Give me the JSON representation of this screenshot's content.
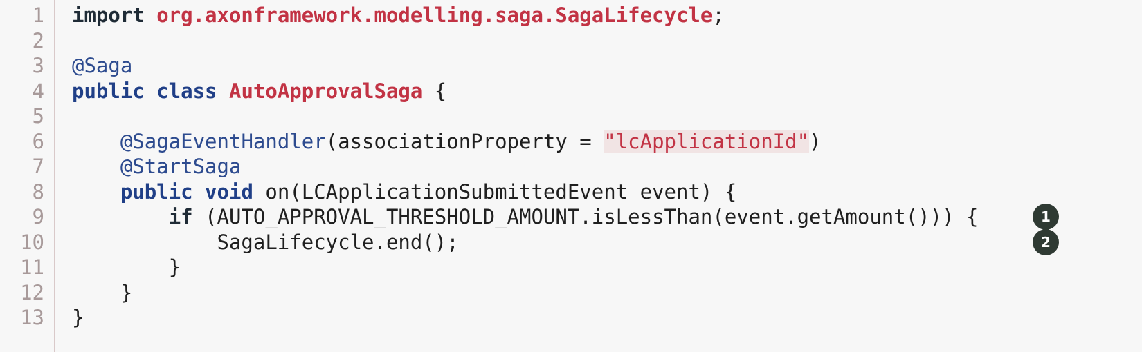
{
  "code": {
    "lines": [
      {
        "number": "1",
        "tokens": [
          {
            "text": "import ",
            "style": "kw"
          },
          {
            "text": "org.axonframework.modelling.saga.SagaLifecycle",
            "style": "pkg"
          },
          {
            "text": ";",
            "style": "plain"
          }
        ]
      },
      {
        "number": "2",
        "tokens": []
      },
      {
        "number": "3",
        "tokens": [
          {
            "text": "@Saga",
            "style": "ann"
          }
        ]
      },
      {
        "number": "4",
        "tokens": [
          {
            "text": "public class ",
            "style": "kwb"
          },
          {
            "text": "AutoApprovalSaga",
            "style": "cls"
          },
          {
            "text": " {",
            "style": "plain"
          }
        ]
      },
      {
        "number": "5",
        "tokens": []
      },
      {
        "number": "6",
        "tokens": [
          {
            "text": "    ",
            "style": "plain"
          },
          {
            "text": "@SagaEventHandler",
            "style": "ann"
          },
          {
            "text": "(associationProperty = ",
            "style": "plain"
          },
          {
            "text": "\"lcApplicationId\"",
            "style": "str"
          },
          {
            "text": ")",
            "style": "plain"
          }
        ]
      },
      {
        "number": "7",
        "tokens": [
          {
            "text": "    ",
            "style": "plain"
          },
          {
            "text": "@StartSaga",
            "style": "ann"
          }
        ]
      },
      {
        "number": "8",
        "tokens": [
          {
            "text": "    ",
            "style": "plain"
          },
          {
            "text": "public void",
            "style": "kwb"
          },
          {
            "text": " on(LCApplicationSubmittedEvent event) {",
            "style": "plain"
          }
        ]
      },
      {
        "number": "9",
        "tokens": [
          {
            "text": "        ",
            "style": "plain"
          },
          {
            "text": "if",
            "style": "kw"
          },
          {
            "text": " (AUTO_APPROVAL_THRESHOLD_AMOUNT.isLessThan(event.getAmount())) {",
            "style": "plain"
          }
        ]
      },
      {
        "number": "10",
        "tokens": [
          {
            "text": "            SagaLifecycle.end();",
            "style": "plain"
          }
        ]
      },
      {
        "number": "11",
        "tokens": [
          {
            "text": "        }",
            "style": "plain"
          }
        ]
      },
      {
        "number": "12",
        "tokens": [
          {
            "text": "    }",
            "style": "plain"
          }
        ]
      },
      {
        "number": "13",
        "tokens": [
          {
            "text": "}",
            "style": "plain"
          }
        ]
      }
    ]
  },
  "callouts": [
    {
      "label": "1",
      "line": 9
    },
    {
      "label": "2",
      "line": 10
    }
  ],
  "colors": {
    "background": "#f7f7f7",
    "keyword": "#1f2b36",
    "keyword_blue": "#203f87",
    "annotation": "#2d4b8f",
    "identifier_red": "#c23344",
    "string_background": "#f1e4e4",
    "line_number": "#a89a9a",
    "callout_background": "#2f3a33"
  }
}
